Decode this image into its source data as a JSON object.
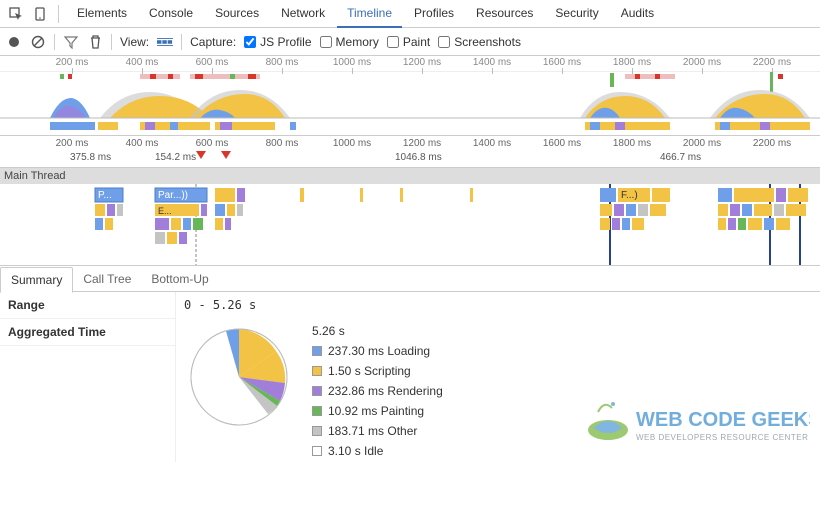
{
  "mainTabs": [
    "Elements",
    "Console",
    "Sources",
    "Network",
    "Timeline",
    "Profiles",
    "Resources",
    "Security",
    "Audits"
  ],
  "activeTab": "Timeline",
  "toolbar": {
    "viewLabel": "View:",
    "captureLabel": "Capture:",
    "jsProfile": "JS Profile",
    "memory": "Memory",
    "paint": "Paint",
    "screenshots": "Screenshots"
  },
  "ruler": {
    "ticks": [
      "200 ms",
      "400 ms",
      "600 ms",
      "800 ms",
      "1000 ms",
      "1200 ms",
      "1400 ms",
      "1600 ms",
      "1800 ms",
      "2000 ms",
      "2200 ms"
    ]
  },
  "sublabels": [
    "375.8 ms",
    "154.2 ms",
    "1046.8 ms",
    "466.7 ms"
  ],
  "mainThread": "Main Thread",
  "flameBlocks": [
    "P...",
    "Par...))",
    "E...",
    "F...)"
  ],
  "subTabs": [
    "Summary",
    "Call Tree",
    "Bottom-Up"
  ],
  "activeSubTab": "Summary",
  "summary": {
    "rangeLabel": "Range",
    "rangeValue": "0 - 5.26 s",
    "aggLabel": "Aggregated Time",
    "total": "5.26 s",
    "legend": [
      {
        "color": "#6f9fe8",
        "label": "237.30 ms Loading"
      },
      {
        "color": "#f2c344",
        "label": "1.50 s Scripting"
      },
      {
        "color": "#a27edb",
        "label": "232.86 ms Rendering"
      },
      {
        "color": "#67b657",
        "label": "10.92 ms Painting"
      },
      {
        "color": "#c4c4c4",
        "label": "183.71 ms Other"
      },
      {
        "color": "#ffffff",
        "label": "3.10 s Idle"
      }
    ]
  },
  "watermark": {
    "line1": "WEB CODE GEEKS",
    "line2": "WEB DEVELOPERS RESOURCE CENTER"
  },
  "chart_data": {
    "type": "pie",
    "title": "Aggregated Time",
    "series": [
      {
        "name": "Loading",
        "value": 237.3,
        "unit": "ms"
      },
      {
        "name": "Scripting",
        "value": 1500,
        "unit": "ms"
      },
      {
        "name": "Rendering",
        "value": 232.86,
        "unit": "ms"
      },
      {
        "name": "Painting",
        "value": 10.92,
        "unit": "ms"
      },
      {
        "name": "Other",
        "value": 183.71,
        "unit": "ms"
      },
      {
        "name": "Idle",
        "value": 3100,
        "unit": "ms"
      }
    ],
    "total_ms": 5260
  }
}
